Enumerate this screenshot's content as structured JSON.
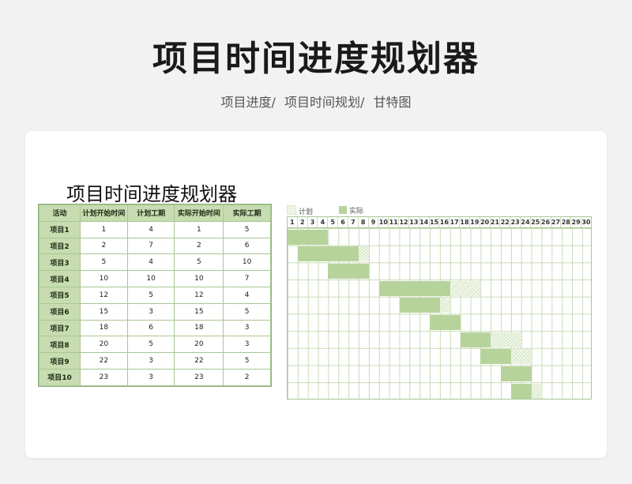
{
  "page": {
    "title": "项目时间进度规划器",
    "breadcrumb": [
      "项目进度/",
      "项目时间规划/",
      "甘特图"
    ]
  },
  "sheet": {
    "title": "项目时间进度规划器",
    "columns": [
      "活动",
      "计划开始时间",
      "计划工期",
      "实际开始时间",
      "实际工期"
    ],
    "rows": [
      {
        "name": "项目1",
        "plan_start": 1,
        "plan_dur": 4,
        "act_start": 1,
        "act_dur": 5
      },
      {
        "name": "项目2",
        "plan_start": 2,
        "plan_dur": 7,
        "act_start": 2,
        "act_dur": 6
      },
      {
        "name": "项目3",
        "plan_start": 5,
        "plan_dur": 4,
        "act_start": 5,
        "act_dur": 10
      },
      {
        "name": "项目4",
        "plan_start": 10,
        "plan_dur": 10,
        "act_start": 10,
        "act_dur": 7
      },
      {
        "name": "项目5",
        "plan_start": 12,
        "plan_dur": 5,
        "act_start": 12,
        "act_dur": 4
      },
      {
        "name": "项目6",
        "plan_start": 15,
        "plan_dur": 3,
        "act_start": 15,
        "act_dur": 5
      },
      {
        "name": "项目7",
        "plan_start": 18,
        "plan_dur": 6,
        "act_start": 18,
        "act_dur": 3
      },
      {
        "name": "项目8",
        "plan_start": 20,
        "plan_dur": 5,
        "act_start": 20,
        "act_dur": 3
      },
      {
        "name": "项目9",
        "plan_start": 22,
        "plan_dur": 3,
        "act_start": 22,
        "act_dur": 5
      },
      {
        "name": "项目10",
        "plan_start": 23,
        "plan_dur": 3,
        "act_start": 23,
        "act_dur": 2
      }
    ]
  },
  "gantt": {
    "legend": {
      "plan": "计划",
      "actual": "实际"
    },
    "days": [
      1,
      2,
      3,
      4,
      5,
      6,
      7,
      8,
      9,
      10,
      11,
      12,
      13,
      14,
      15,
      16,
      17,
      18,
      19,
      20,
      21,
      22,
      23,
      24,
      25,
      26,
      27,
      28,
      29,
      30
    ],
    "colors": {
      "plan": "#e4efd8",
      "actual": "#b7d39c",
      "grid": "#c9dbb8"
    },
    "bars": [
      {
        "plan_start": 1,
        "plan_days": 4,
        "act_start": 1,
        "act_days": 4
      },
      {
        "plan_start": 2,
        "plan_days": 7,
        "act_start": 2,
        "act_days": 6
      },
      {
        "plan_start": 5,
        "plan_days": 4,
        "act_start": 5,
        "act_days": 4
      },
      {
        "plan_start": 10,
        "plan_days": 10,
        "act_start": 10,
        "act_days": 7
      },
      {
        "plan_start": 12,
        "plan_days": 5,
        "act_start": 12,
        "act_days": 4
      },
      {
        "plan_start": 15,
        "plan_days": 3,
        "act_start": 15,
        "act_days": 3
      },
      {
        "plan_start": 18,
        "plan_days": 6,
        "act_start": 18,
        "act_days": 3
      },
      {
        "plan_start": 20,
        "plan_days": 5,
        "act_start": 20,
        "act_days": 3
      },
      {
        "plan_start": 22,
        "plan_days": 3,
        "act_start": 22,
        "act_days": 3
      },
      {
        "plan_start": 23,
        "plan_days": 3,
        "act_start": 23,
        "act_days": 2
      }
    ]
  }
}
